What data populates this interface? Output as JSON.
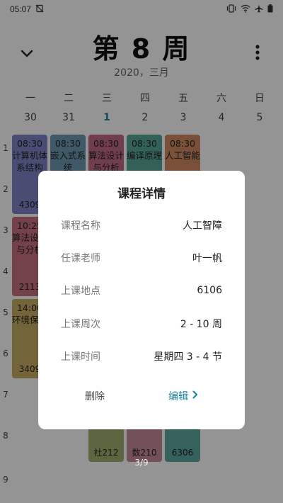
{
  "status_bar": {
    "time": "05:07"
  },
  "header": {
    "week_title": "第 8 周",
    "month_label": "2020，三月"
  },
  "weekdays": [
    "一",
    "二",
    "三",
    "四",
    "五",
    "六",
    "日"
  ],
  "dates": [
    "30",
    "31",
    "1",
    "2",
    "3",
    "4",
    "5"
  ],
  "periods": [
    "1",
    "2",
    "3",
    "4",
    "5",
    "6",
    "7",
    "8",
    "9"
  ],
  "courses": [
    {
      "time": "08:30",
      "name": "计算机体系结构",
      "room": "4309",
      "color": "#7e86c9"
    },
    {
      "time": "08:30",
      "name": "嵌入式系统",
      "room": "",
      "color": "#6f9ab3"
    },
    {
      "time": "08:30",
      "name": "算法设计与分析",
      "room": "",
      "color": "#c16a86"
    },
    {
      "time": "08:30",
      "name": "编译原理",
      "room": "",
      "color": "#58a89c"
    },
    {
      "time": "08:30",
      "name": "人工智能",
      "room": "",
      "color": "#d28a63"
    },
    {
      "time": "10:25",
      "name": "算法设计与分析",
      "room": "2113",
      "color": "#c8707f"
    },
    {
      "time": "14:00",
      "name": "环境保护",
      "room": "3409",
      "color": "#c9ad63"
    },
    {
      "time": "",
      "name": "",
      "room": "社212",
      "color": "#9fb070"
    },
    {
      "time": "",
      "name": "",
      "room": "数210",
      "color": "#c48c9a"
    },
    {
      "time": "",
      "name": "",
      "room": "6306",
      "color": "#5fa7a1"
    }
  ],
  "page_indicator": "3/9",
  "dialog": {
    "title": "课程详情",
    "rows": [
      {
        "label": "课程名称",
        "value": "人工智障"
      },
      {
        "label": "任课老师",
        "value": "叶一帆"
      },
      {
        "label": "上课地点",
        "value": "6106"
      },
      {
        "label": "上课周次",
        "value": "2 - 10 周"
      },
      {
        "label": "上课时间",
        "value": "星期四 3 - 4 节"
      }
    ],
    "delete_label": "删除",
    "edit_label": "编辑"
  },
  "colors": {
    "accent": "#1a7fa0"
  }
}
